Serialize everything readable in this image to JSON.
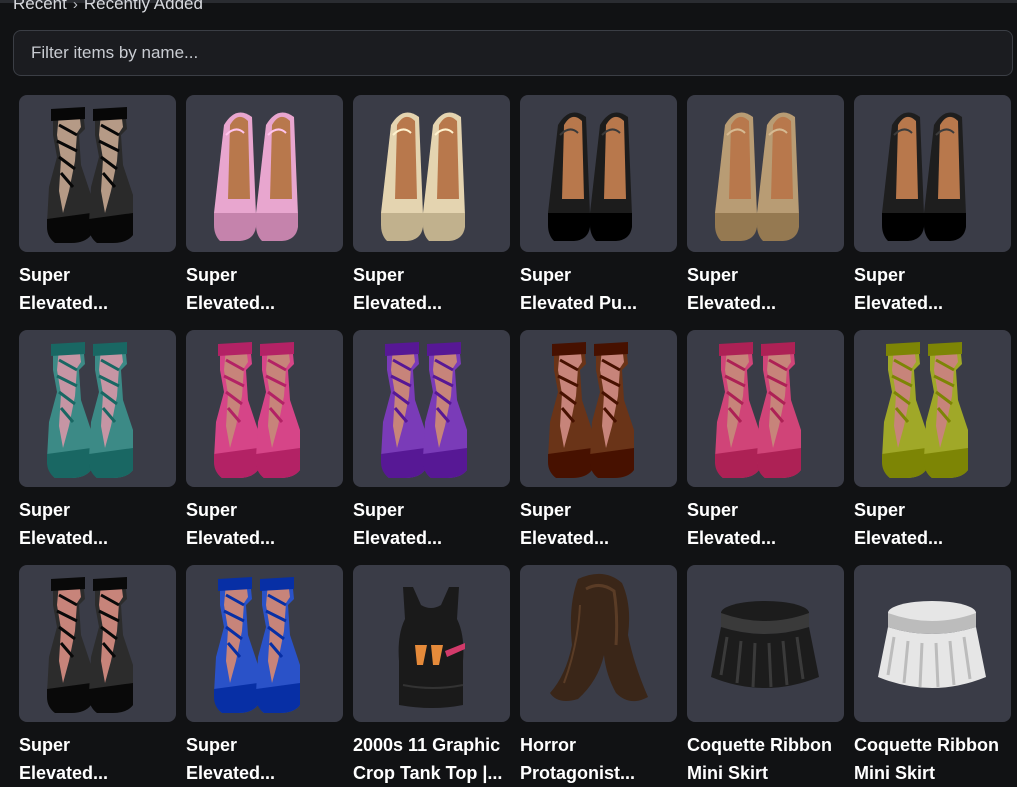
{
  "breadcrumb": {
    "parent": "Recent",
    "current": "Recently Added"
  },
  "filter": {
    "placeholder": "Filter items by name..."
  },
  "colors": {
    "page_background": "#111214",
    "card_background": "#3a3c47"
  },
  "items": [
    {
      "name": "Super\nElevated...",
      "kind": "laced-heel-icon",
      "color": "#2a2a2a",
      "accent": "#b59a86"
    },
    {
      "name": "Super\nElevated...",
      "kind": "platform-mule-icon",
      "color": "#e8a6cf",
      "accent": "#b8784c"
    },
    {
      "name": "Super\nElevated...",
      "kind": "platform-mule-icon",
      "color": "#e4d4b0",
      "accent": "#b8784c"
    },
    {
      "name": "Super\nElevated Pu...",
      "kind": "platform-mule-icon",
      "color": "#1c1c1c",
      "accent": "#b8784c"
    },
    {
      "name": "Super\nElevated...",
      "kind": "platform-mule-icon",
      "color": "#b89c74",
      "accent": "#b8784c"
    },
    {
      "name": "Super\nElevated...",
      "kind": "platform-mule-icon",
      "color": "#1e1e1e",
      "accent": "#b8784c"
    },
    {
      "name": "Super\nElevated...",
      "kind": "laced-heel-icon",
      "color": "#3c8a86",
      "accent": "#c695a4"
    },
    {
      "name": "Super\nElevated...",
      "kind": "laced-heel-icon",
      "color": "#d64588",
      "accent": "#c7847a"
    },
    {
      "name": "Super\nElevated...",
      "kind": "laced-heel-icon",
      "color": "#7a3bb8",
      "accent": "#c7847a"
    },
    {
      "name": "Super\nElevated...",
      "kind": "laced-heel-icon",
      "color": "#6a3418",
      "accent": "#c7847a"
    },
    {
      "name": "Super\nElevated...",
      "kind": "laced-heel-icon",
      "color": "#d04478",
      "accent": "#c7847a"
    },
    {
      "name": "Super\nElevated...",
      "kind": "laced-heel-icon",
      "color": "#a0a828",
      "accent": "#c7847a"
    },
    {
      "name": "Super\nElevated...",
      "kind": "laced-heel-icon",
      "color": "#2c2c2c",
      "accent": "#c7847a"
    },
    {
      "name": "Super\nElevated...",
      "kind": "laced-heel-icon",
      "color": "#2a52c8",
      "accent": "#c7847a"
    },
    {
      "name": "2000s 11 Graphic\nCrop Tank Top |...",
      "kind": "tank-top-icon",
      "color": "#1a1a1a",
      "accent": "#d23a6a"
    },
    {
      "name": "Horror\nProtagonist...",
      "kind": "long-hair-icon",
      "color": "#3a2618",
      "accent": "#5a3c26"
    },
    {
      "name": "Coquette Ribbon\nMini Skirt",
      "kind": "mini-skirt-icon",
      "color": "#1c1c1c",
      "accent": "#3a3a3a"
    },
    {
      "name": "Coquette Ribbon\nMini Skirt",
      "kind": "mini-skirt-icon",
      "color": "#e6e6e6",
      "accent": "#bcbcbc"
    }
  ]
}
